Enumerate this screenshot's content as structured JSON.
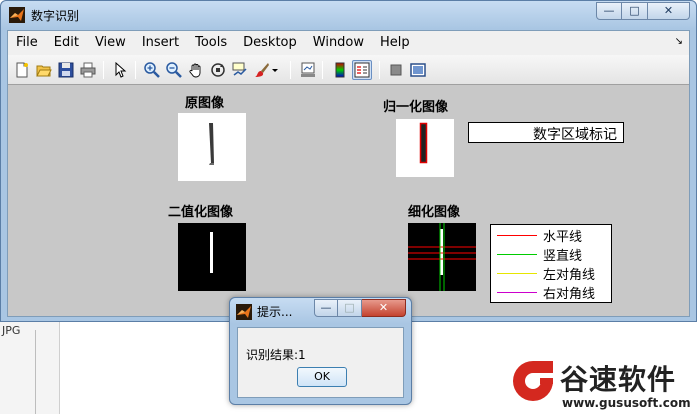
{
  "window": {
    "title": "数字识别",
    "minimize_label": "—",
    "maximize_label": "□",
    "close_label": "✕"
  },
  "menu": {
    "items": [
      {
        "label": "File"
      },
      {
        "label": "Edit"
      },
      {
        "label": "View"
      },
      {
        "label": "Insert"
      },
      {
        "label": "Tools"
      },
      {
        "label": "Desktop"
      },
      {
        "label": "Window"
      },
      {
        "label": "Help"
      }
    ],
    "overflow_icon": "double-chevron-icon"
  },
  "toolbar": {
    "icons": [
      "new-figure-icon",
      "open-file-icon",
      "save-icon",
      "print-icon",
      "pointer-icon",
      "zoom-in-icon",
      "zoom-out-icon",
      "pan-hand-icon",
      "rotate-3d-icon",
      "data-cursor-icon",
      "brush-icon",
      "brush-dropdown-icon",
      "link-plot-icon",
      "colorbar-icon",
      "legend-icon",
      "hide-plot-tools-icon",
      "show-plot-tools-icon"
    ]
  },
  "figure": {
    "panels": {
      "original": {
        "title": "原图像"
      },
      "normalized": {
        "title": "归一化图像",
        "region_label": "数字区域标记"
      },
      "binary": {
        "title": "二值化图像"
      },
      "thinned": {
        "title": "细化图像"
      }
    },
    "legend": {
      "items": [
        {
          "label": "水平线",
          "color": "#ff0000"
        },
        {
          "label": "竖直线",
          "color": "#00cc00"
        },
        {
          "label": "左对角线",
          "color": "#e6e600"
        },
        {
          "label": "右对角线",
          "color": "#cc00cc"
        }
      ]
    }
  },
  "dialog": {
    "title": "提示...",
    "message": "识别结果:1",
    "ok_label": "OK"
  },
  "background": {
    "file_type": "JPG"
  },
  "watermark": {
    "brand": "谷速软件",
    "url": "www.gususoft.com"
  },
  "colors": {
    "accent": "#d4281f",
    "titlebar": "#a9c6e3",
    "figure_bg": "#c8c8c8"
  }
}
